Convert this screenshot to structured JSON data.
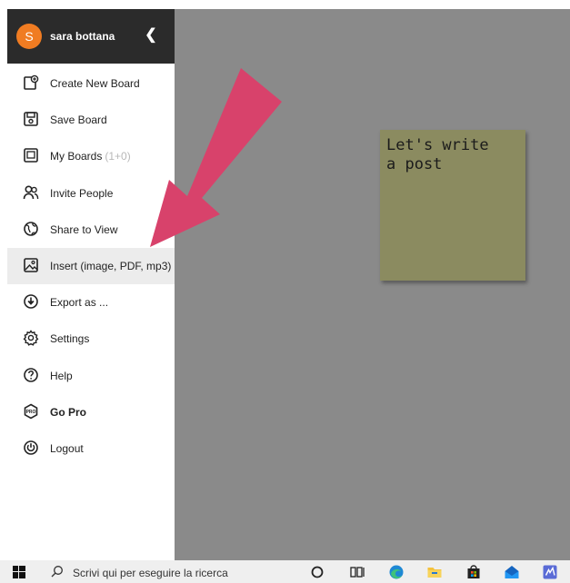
{
  "user": {
    "initial": "S",
    "name": "sara bottana",
    "avatar_color": "#f07c22",
    "collapse_icon": "chevron-left-icon"
  },
  "menu": [
    {
      "id": "create-new-board",
      "label": "Create New Board",
      "icon": "new-board-icon"
    },
    {
      "id": "save-board",
      "label": "Save Board",
      "icon": "save-icon"
    },
    {
      "id": "my-boards",
      "label": "My Boards",
      "count": "(1+0)",
      "icon": "boards-icon"
    },
    {
      "id": "invite-people",
      "label": "Invite People",
      "icon": "people-icon"
    },
    {
      "id": "share-to-view",
      "label": "Share to View",
      "icon": "globe-icon"
    },
    {
      "id": "insert",
      "label": "Insert (image, PDF, mp3)",
      "icon": "image-icon",
      "highlighted": true
    },
    {
      "id": "export-as",
      "label": "Export as ...",
      "icon": "download-icon"
    },
    {
      "id": "settings",
      "label": "Settings",
      "icon": "gear-icon"
    },
    {
      "id": "help",
      "label": "Help",
      "icon": "help-icon"
    },
    {
      "id": "go-pro",
      "label": "Go Pro",
      "icon": "pro-icon",
      "bold": true
    },
    {
      "id": "logout",
      "label": "Logout",
      "icon": "power-icon"
    }
  ],
  "canvas": {
    "background": "#8a8a8a",
    "sticky_note": {
      "text": "Let's write\na post",
      "color": "#8b8b60"
    },
    "annotation_arrow_color": "#d8426b"
  },
  "taskbar": {
    "search_placeholder": "Scrivi qui per eseguire la ricerca",
    "icons": [
      "windows-start-icon",
      "search-icon",
      "cortana-icon",
      "task-view-icon",
      "edge-icon",
      "file-explorer-icon",
      "store-icon",
      "mail-icon",
      "whiteboard-icon"
    ]
  }
}
